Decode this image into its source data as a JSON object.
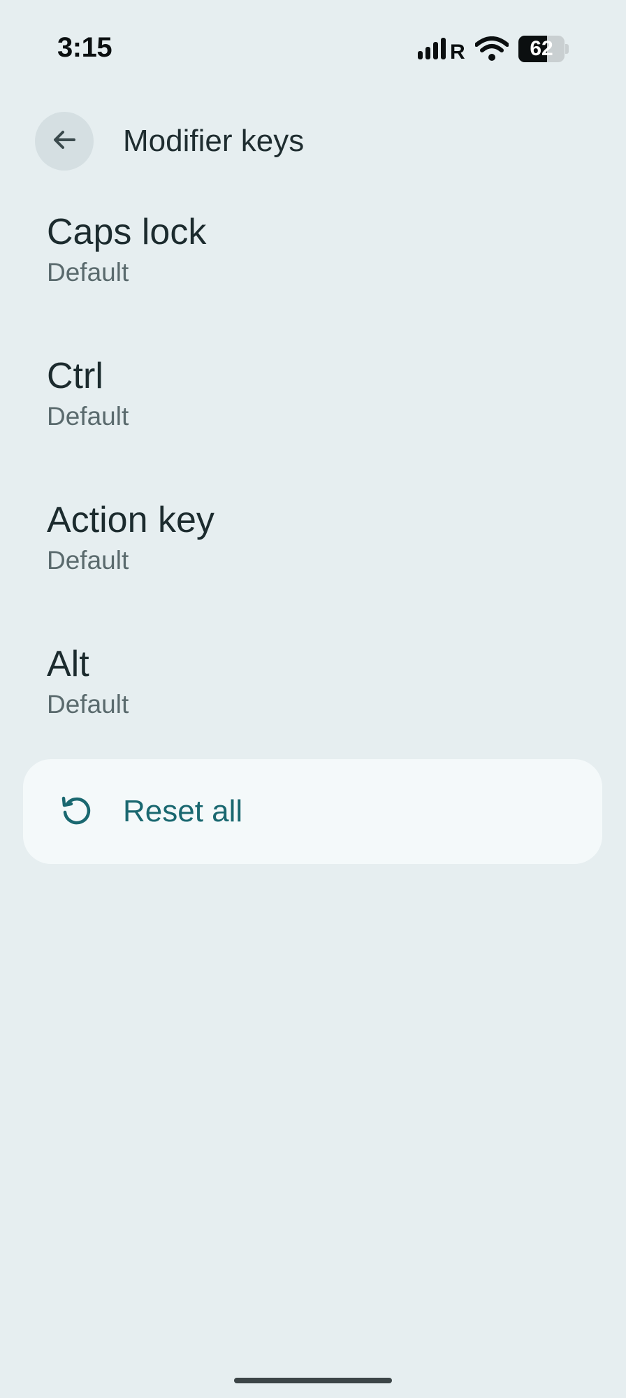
{
  "status_bar": {
    "time": "3:15",
    "battery_level": "62",
    "battery_fraction": 0.62,
    "signal_icon": "signal-roaming-icon",
    "wifi_icon": "wifi-icon"
  },
  "app_bar": {
    "back_icon": "arrow-back-icon",
    "title": "Modifier keys"
  },
  "items": [
    {
      "title": "Caps lock",
      "subtitle": "Default"
    },
    {
      "title": "Ctrl",
      "subtitle": "Default"
    },
    {
      "title": "Action key",
      "subtitle": "Default"
    },
    {
      "title": "Alt",
      "subtitle": "Default"
    }
  ],
  "reset": {
    "icon": "reset-icon",
    "label": "Reset all"
  },
  "colors": {
    "background": "#e6eef0",
    "accent": "#1a6870",
    "card": "#f4f9fa"
  }
}
